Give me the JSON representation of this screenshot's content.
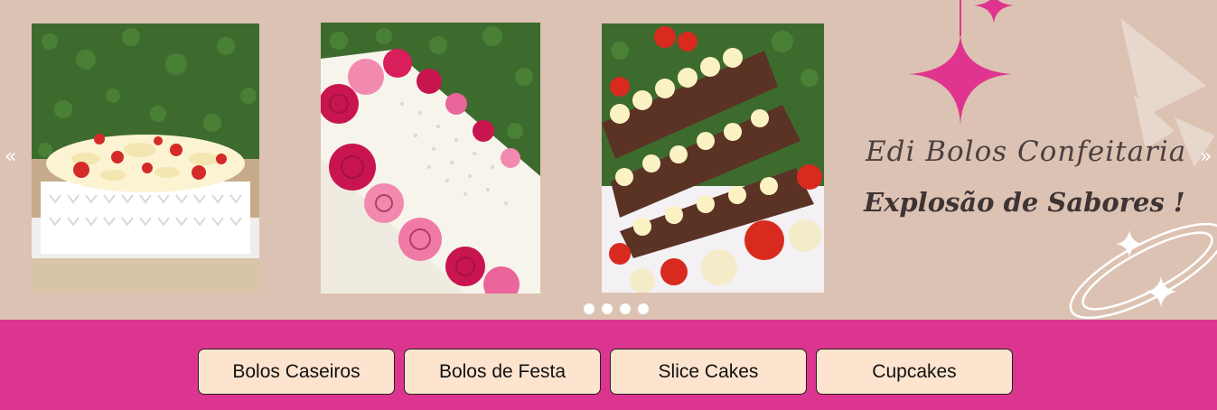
{
  "carousel": {
    "prev_label": "«",
    "next_label": "»",
    "slide_count": 4,
    "active_index": 0,
    "images": [
      {
        "icon": "strawberry-white-chocolate-cake-photo"
      },
      {
        "icon": "rose-frosted-cake-photo"
      },
      {
        "icon": "naked-chocolate-cake-photo"
      }
    ]
  },
  "brand": {
    "name": "Edi Bolos Confeitaria",
    "tagline": "Explosão de Sabores !"
  },
  "nav": {
    "buttons": [
      "Bolos Caseiros",
      "Bolos de Festa",
      "Slice Cakes",
      "Cupcakes"
    ]
  },
  "colors": {
    "hero_bg": "#dcc2b3",
    "nav_bg": "#dc3590",
    "button_bg": "#fde4cf",
    "sparkle": "#e0358f"
  }
}
